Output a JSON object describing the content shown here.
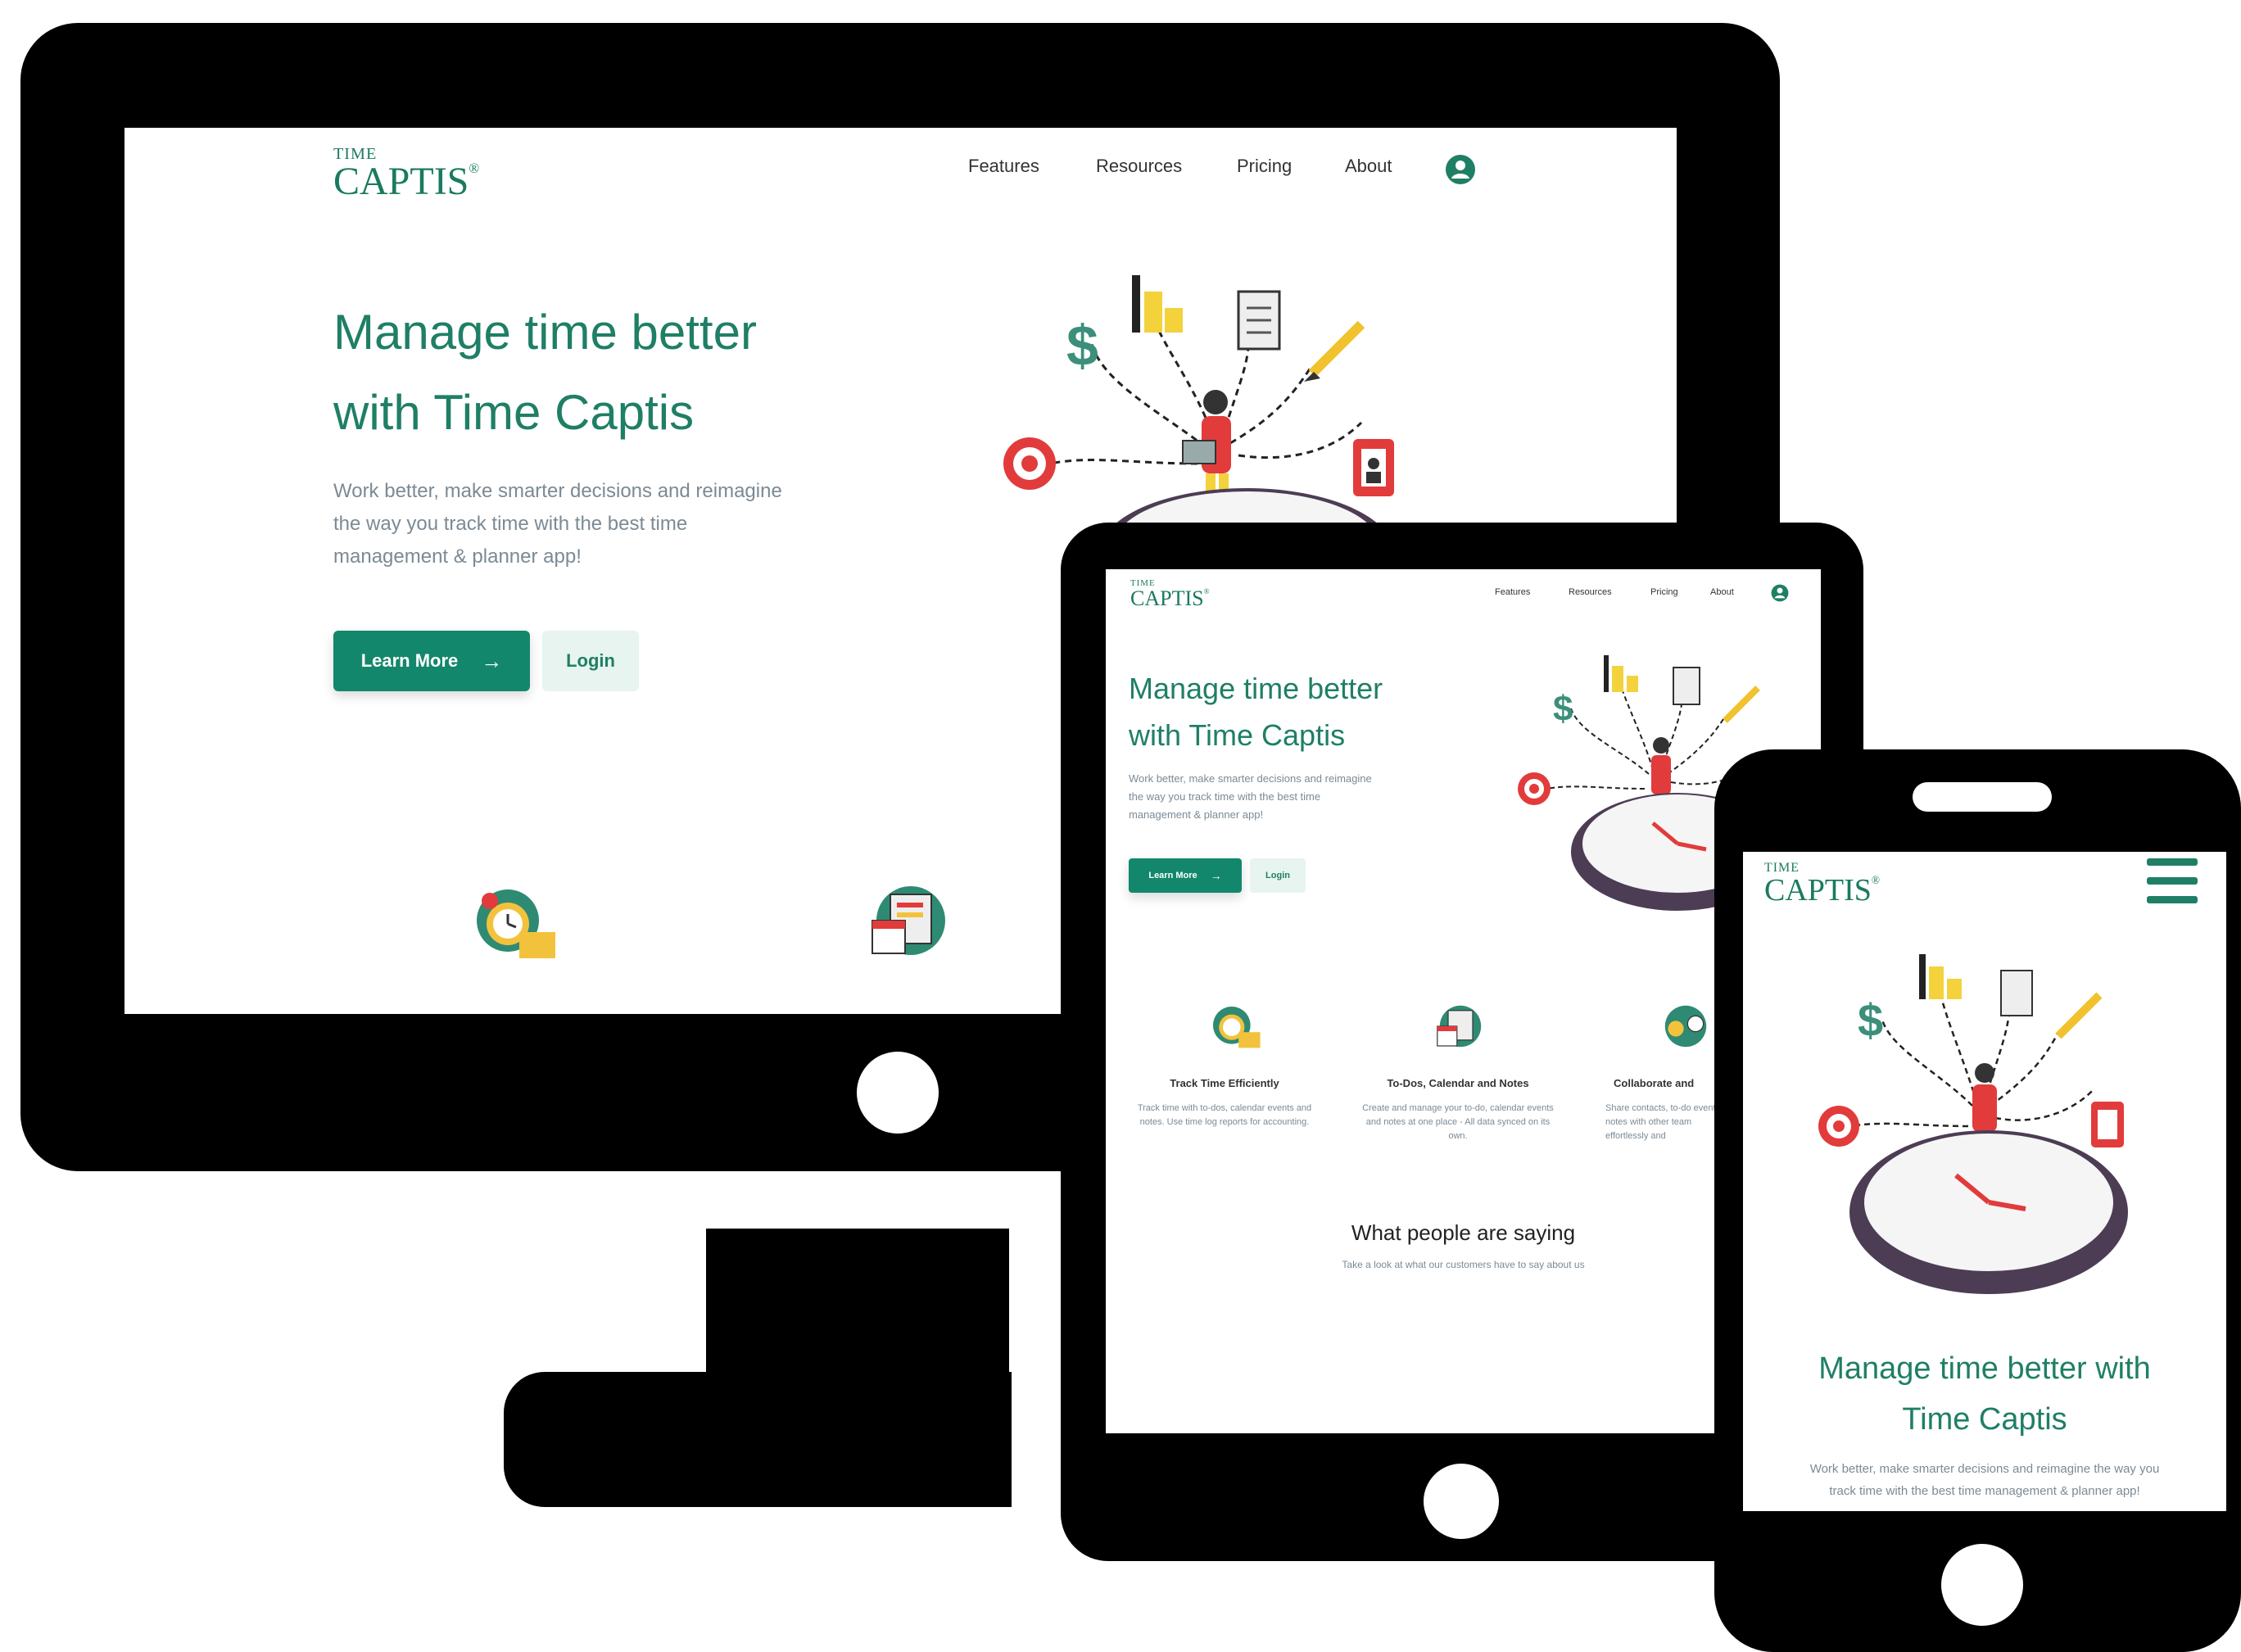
{
  "brand": {
    "logo_small": "TIME",
    "logo_big": "CAPTIS",
    "logo_mark": "®"
  },
  "nav": {
    "items": [
      "Features",
      "Resources",
      "Pricing",
      "About"
    ],
    "account_icon": "user-circle-icon"
  },
  "hero": {
    "title_line1": "Manage time better",
    "title_line2": "with Time Captis",
    "subtitle_line1": "Work better, make smarter decisions and reimagine",
    "subtitle_line2": "the way you track time with the best time",
    "subtitle_line3": "management & planner app!",
    "learn_more": "Learn More",
    "login": "Login",
    "arrow_icon": "arrow-right-icon"
  },
  "features": [
    {
      "title": "Track Time Efficiently",
      "text": "Track time with to-dos, calendar events and notes. Use time log reports for accounting."
    },
    {
      "title": "To-Dos, Calendar and Notes",
      "text": "Create and manage your to-do, calendar events and notes at one place - All data synced on its own."
    },
    {
      "title": "Collaborate and",
      "text": "Share contacts, to-do events, notes with other team effortlessly and"
    }
  ],
  "testimonials": {
    "title": "What people are saying",
    "subtitle": "Take a look at what our customers have to say about us"
  },
  "phone": {
    "title_line1": "Manage time better with",
    "title_line2": "Time Captis",
    "subtitle_line1": "Work better, make smarter decisions and reimagine the way you",
    "subtitle_line2": "track time with the best time management & planner app!",
    "menu_icon": "hamburger-menu-icon"
  },
  "colors": {
    "brand_green": "#13876b",
    "text_green": "#1f7f66",
    "device_frame": "#000000"
  }
}
